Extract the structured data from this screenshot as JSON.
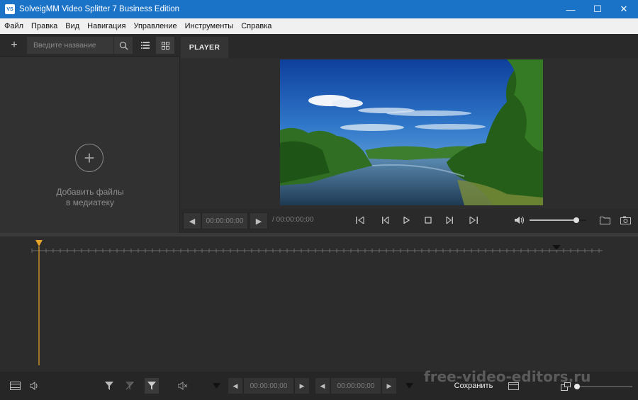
{
  "window": {
    "app_icon": "VS",
    "title": "SolveigMM Video Splitter 7 Business Edition",
    "controls": [
      "minimize-icon",
      "maximize-icon",
      "close-icon"
    ]
  },
  "menu": [
    "Файл",
    "Правка",
    "Вид",
    "Навигация",
    "Управление",
    "Инструменты",
    "Справка"
  ],
  "library": {
    "search_placeholder": "Введите название",
    "empty_label": "Добавить файлы\nв медиатеку"
  },
  "player": {
    "tab": "PLAYER",
    "current_time": "00:00:00;00",
    "total_time": "/ 00:00:00;00",
    "volume": 0.82
  },
  "bottom": {
    "time_in": "00:00:00;00",
    "time_out": "00:00:00;00",
    "save_label": "Сохранить"
  },
  "watermark": "free-video-editors.ru",
  "colors": {
    "titlebar": "#1b73c8",
    "accent_marker": "#e8a42a",
    "panel": "#2b2b2b"
  }
}
